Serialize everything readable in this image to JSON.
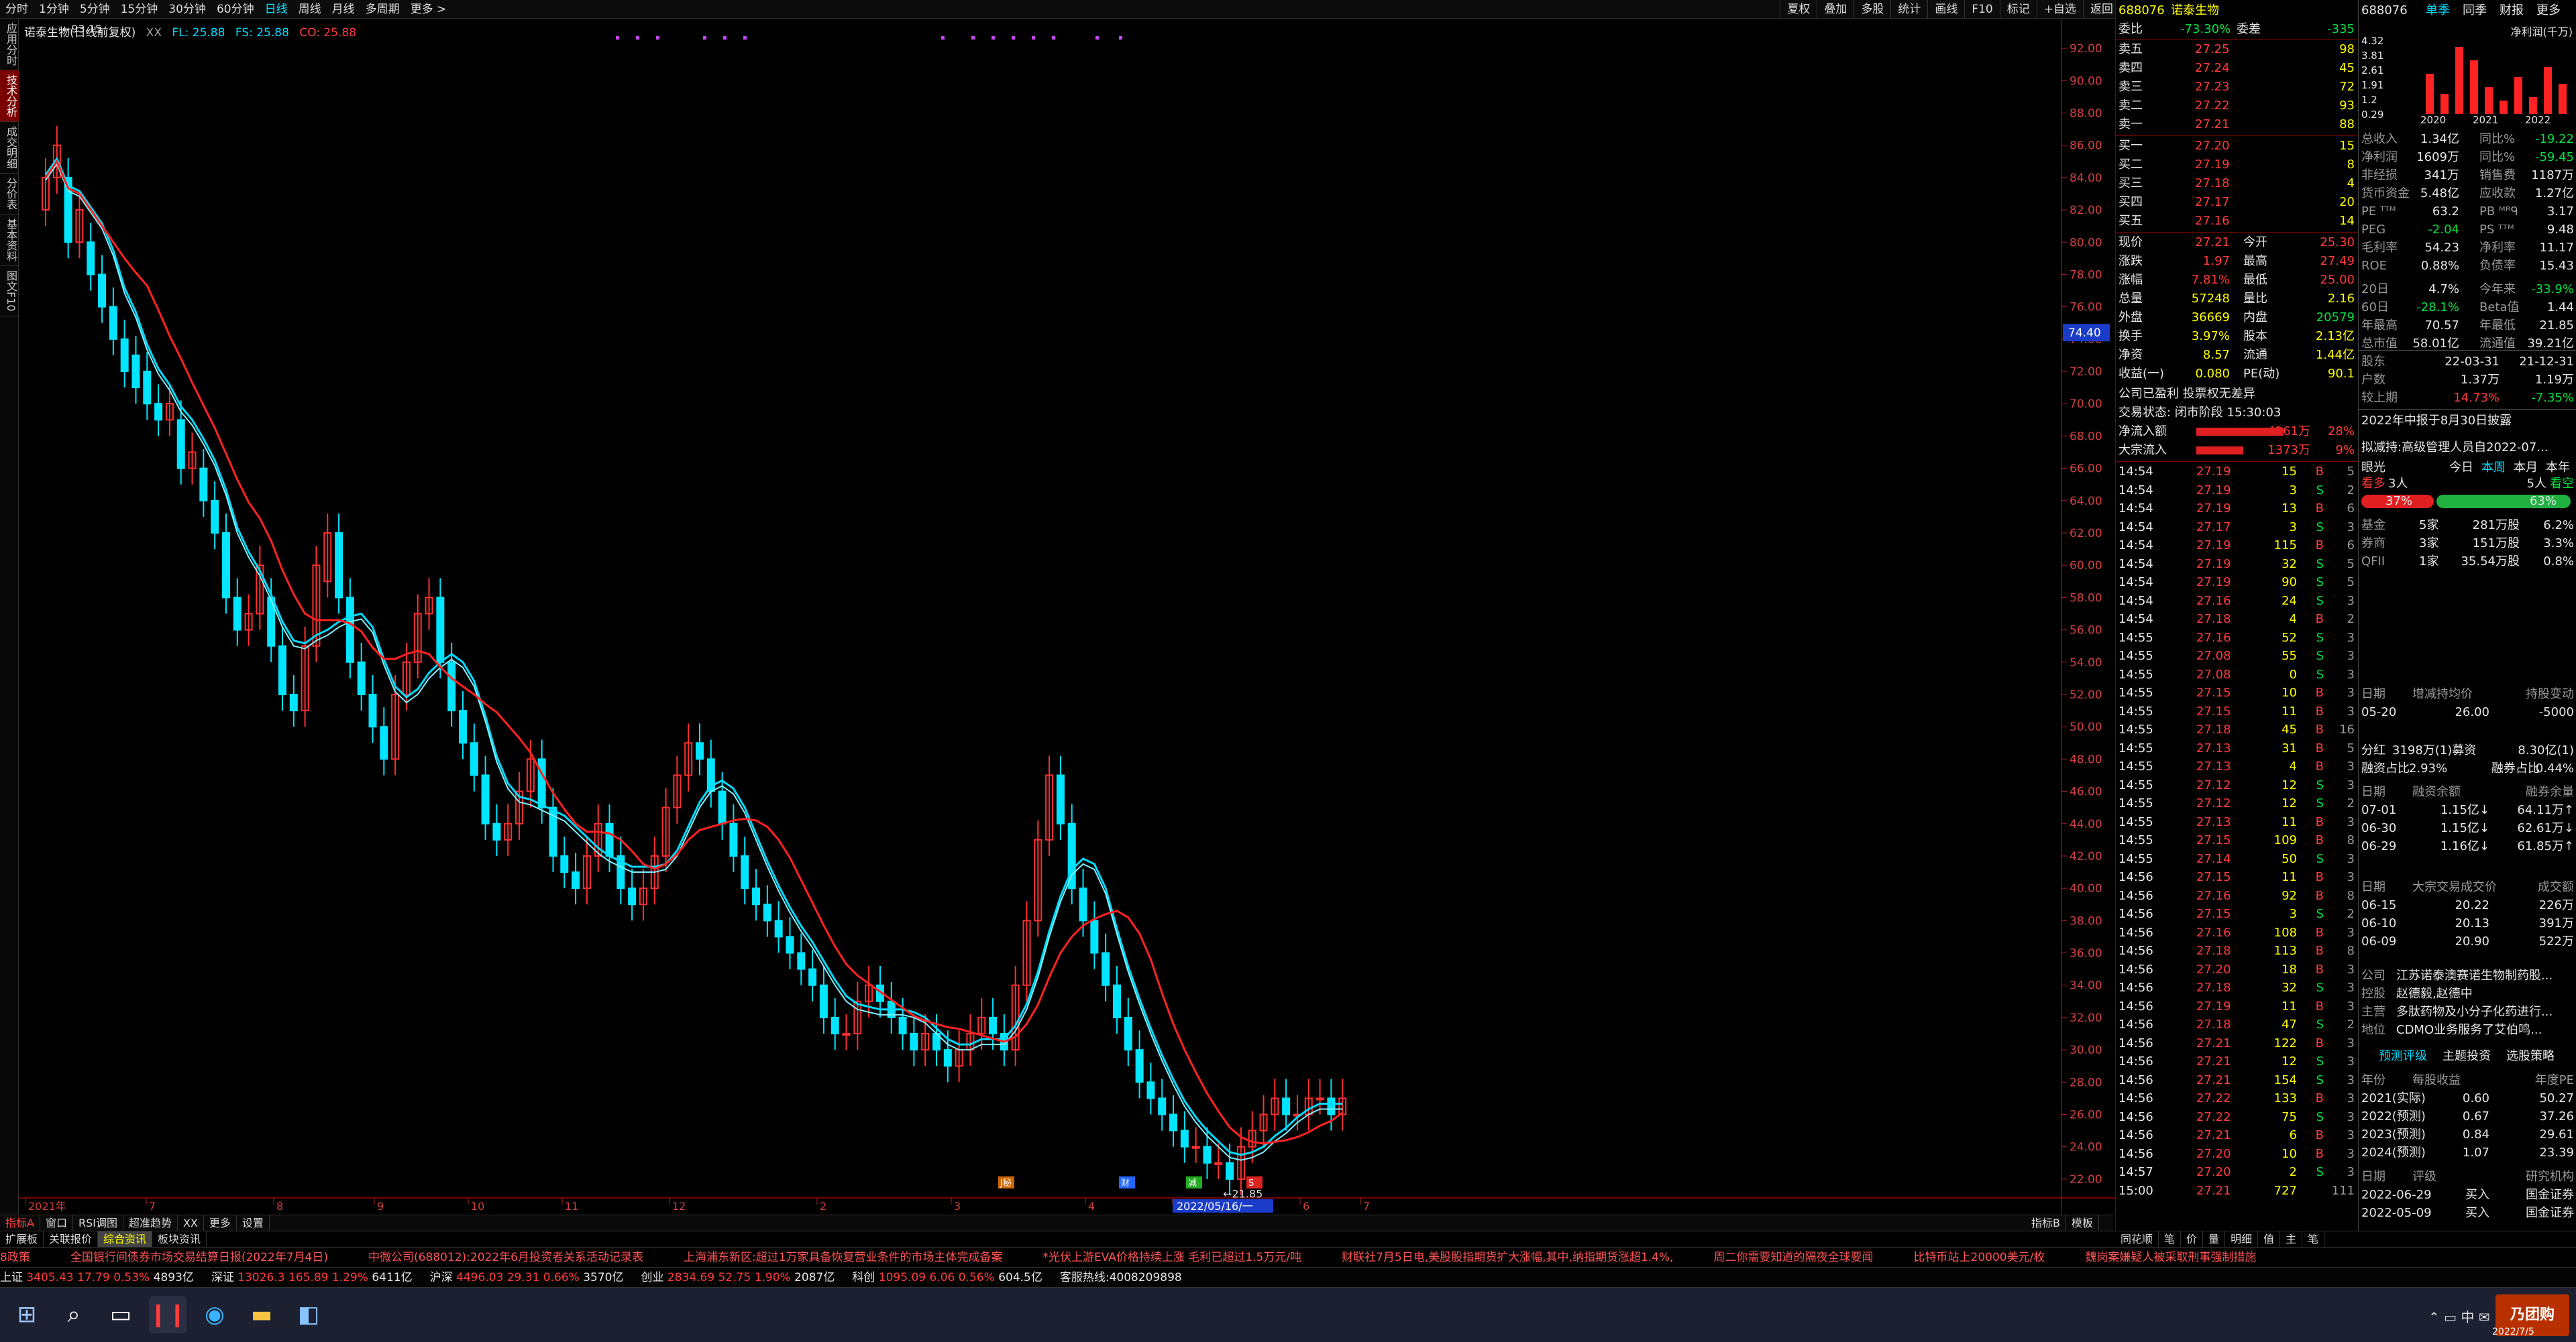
{
  "periods": [
    "分时",
    "1分钟",
    "5分钟",
    "15分钟",
    "30分钟",
    "60分钟",
    "日线",
    "周线",
    "月线",
    "多周期",
    "更多 >"
  ],
  "active_period": "日线",
  "top_buttons": [
    "夏权",
    "叠加",
    "多股",
    "统计",
    "画线",
    "F10",
    "标记",
    "+自选",
    "返回"
  ],
  "left_tabs": [
    "应用分时",
    "技术分析",
    "成交明细",
    "分价表",
    "基本资料",
    "图文F10"
  ],
  "legend": {
    "name": "诺泰生物(日线前复权)",
    "xx": "XX",
    "fl": "FL: 25.88",
    "fs": "FS: 25.88",
    "co": "CO: 25.88"
  },
  "price_axis": [
    "92.00",
    "90.00",
    "88.00",
    "86.00",
    "84.00",
    "82.00",
    "80.00",
    "78.00",
    "76.00",
    "74.00",
    "72.00",
    "70.00",
    "68.00",
    "66.00",
    "64.00",
    "62.00",
    "60.00",
    "58.00",
    "56.00",
    "54.00",
    "52.00",
    "50.00",
    "48.00",
    "46.00",
    "44.00",
    "42.00",
    "40.00",
    "38.00",
    "36.00",
    "34.00",
    "32.00",
    "30.00",
    "28.00",
    "26.00",
    "24.00",
    "22.00"
  ],
  "crosshair_price": "74.40",
  "high_label": "93.15",
  "low_label": "21.85",
  "date_axis": [
    "2021年",
    "7",
    "8",
    "9",
    "10",
    "11",
    "12",
    "2",
    "3",
    "4",
    "5",
    "6",
    "7"
  ],
  "date_highlight": "2022/05/16/一",
  "event_markers": [
    "J秘",
    "财",
    "减",
    "S"
  ],
  "bottom_tabs": [
    "指标A",
    "窗口",
    "RSI调图",
    "超准趋势",
    "XX",
    "更多",
    "设置"
  ],
  "bottom_right": [
    "指标B",
    "模板",
    "板"
  ],
  "bottom_row2": [
    "扩展板",
    "关联报价",
    "综合资讯",
    "板块资讯"
  ],
  "bottom_row2_right": [
    "同花顺",
    "笔",
    "价",
    "量",
    "明细",
    "值",
    "主",
    "笔"
  ],
  "chart_data": {
    "type": "candlestick",
    "title": "诺泰生物(日线前复权)",
    "ylim": [
      21,
      93
    ],
    "indicators": [
      "FL",
      "FS",
      "CO"
    ],
    "highest": 93.15,
    "lowest": 21.85,
    "overlay_lines": [
      {
        "name": "FL",
        "color": "#00dcff"
      },
      {
        "name": "CO",
        "color": "#ff2222"
      }
    ],
    "closes": [
      84,
      86,
      80,
      82,
      78,
      76,
      74,
      72,
      71,
      70,
      69,
      70,
      66,
      67,
      64,
      62,
      58,
      56,
      57,
      60,
      55,
      52,
      51,
      55,
      60,
      62,
      58,
      54,
      52,
      50,
      48,
      52,
      54,
      57,
      58,
      54,
      51,
      49,
      47,
      44,
      43,
      44,
      46,
      48,
      45,
      42,
      41,
      40,
      42,
      44,
      42,
      40,
      39,
      40,
      42,
      45,
      47,
      49,
      48,
      46,
      44,
      42,
      40,
      39,
      38,
      37,
      36,
      35,
      34,
      32,
      31,
      31,
      33,
      34,
      33,
      32,
      31,
      30,
      31,
      30,
      29,
      30,
      31,
      32,
      31,
      30,
      34,
      38,
      43,
      47,
      44,
      40,
      38,
      36,
      34,
      32,
      30,
      28,
      27,
      26,
      25,
      24,
      24,
      23,
      23,
      22,
      24,
      25,
      26,
      27,
      26,
      26,
      27,
      27,
      26,
      27
    ],
    "opens": [
      82,
      84,
      84,
      80,
      80,
      78,
      76,
      74,
      73,
      72,
      70,
      69,
      69,
      66,
      66,
      64,
      62,
      58,
      56,
      57,
      58,
      55,
      52,
      51,
      55,
      59,
      62,
      58,
      54,
      52,
      50,
      48,
      52,
      54,
      57,
      58,
      54,
      51,
      49,
      47,
      44,
      43,
      44,
      46,
      48,
      45,
      42,
      41,
      40,
      42,
      44,
      42,
      40,
      39,
      40,
      42,
      45,
      47,
      49,
      48,
      46,
      44,
      42,
      40,
      39,
      38,
      37,
      36,
      35,
      34,
      32,
      31,
      31,
      33,
      34,
      33,
      32,
      31,
      30,
      31,
      30,
      29,
      30,
      31,
      32,
      31,
      30,
      34,
      38,
      43,
      47,
      44,
      40,
      38,
      36,
      34,
      32,
      30,
      28,
      27,
      26,
      25,
      24,
      24,
      23,
      23,
      22,
      24,
      25,
      26,
      27,
      26,
      26,
      27,
      27,
      26
    ]
  },
  "quote": {
    "code": "688076",
    "name": "诺泰生物",
    "weibi_label": "委比",
    "weibi": "-73.30%",
    "weicha_label": "委差",
    "weicha": "-335",
    "sells": [
      [
        "卖五",
        "27.25",
        "98"
      ],
      [
        "卖四",
        "27.24",
        "45"
      ],
      [
        "卖三",
        "27.23",
        "72"
      ],
      [
        "卖二",
        "27.22",
        "93"
      ],
      [
        "卖一",
        "27.21",
        "88"
      ]
    ],
    "buys": [
      [
        "买一",
        "27.20",
        "15"
      ],
      [
        "买二",
        "27.19",
        "8"
      ],
      [
        "买三",
        "27.18",
        "4"
      ],
      [
        "买四",
        "27.17",
        "20"
      ],
      [
        "买五",
        "27.16",
        "14"
      ]
    ],
    "stats": [
      [
        "现价",
        "27.21",
        "今开",
        "25.30"
      ],
      [
        "涨跌",
        "1.97",
        "最高",
        "27.49"
      ],
      [
        "涨幅",
        "7.81%",
        "最低",
        "25.00"
      ],
      [
        "总量",
        "57248",
        "量比",
        "2.16"
      ],
      [
        "外盘",
        "36669",
        "内盘",
        "20579"
      ],
      [
        "换手",
        "3.97%",
        "股本",
        "2.13亿"
      ],
      [
        "净资",
        "8.57",
        "流通",
        "1.44亿"
      ],
      [
        "收益(一)",
        "0.080",
        "PE(动)",
        "90.1"
      ]
    ],
    "notice": "公司已盈利 投票权无差异",
    "status": "交易状态: 闭市阶段 15:30:03",
    "flow": [
      [
        "净流入额",
        "4261万",
        "28%"
      ],
      [
        "大宗流入",
        "1373万",
        "9%"
      ]
    ],
    "ticks": [
      [
        "14:54",
        "27.19",
        "15",
        "B",
        "5"
      ],
      [
        "14:54",
        "27.19",
        "3",
        "S",
        "2"
      ],
      [
        "14:54",
        "27.19",
        "13",
        "B",
        "6"
      ],
      [
        "14:54",
        "27.17",
        "3",
        "S",
        "3"
      ],
      [
        "14:54",
        "27.19",
        "115",
        "B",
        "6"
      ],
      [
        "14:54",
        "27.19",
        "32",
        "S",
        "5"
      ],
      [
        "14:54",
        "27.19",
        "90",
        "S",
        "5"
      ],
      [
        "14:54",
        "27.16",
        "24",
        "S",
        "3"
      ],
      [
        "14:54",
        "27.18",
        "4",
        "B",
        "2"
      ],
      [
        "14:55",
        "27.16",
        "52",
        "S",
        "3"
      ],
      [
        "14:55",
        "27.08",
        "55",
        "S",
        "3"
      ],
      [
        "14:55",
        "27.08",
        "0",
        "S",
        "3"
      ],
      [
        "14:55",
        "27.15",
        "10",
        "B",
        "3"
      ],
      [
        "14:55",
        "27.15",
        "11",
        "B",
        "3"
      ],
      [
        "14:55",
        "27.18",
        "45",
        "B",
        "16"
      ],
      [
        "14:55",
        "27.13",
        "31",
        "B",
        "5"
      ],
      [
        "14:55",
        "27.13",
        "4",
        "B",
        "3"
      ],
      [
        "14:55",
        "27.12",
        "12",
        "S",
        "3"
      ],
      [
        "14:55",
        "27.12",
        "12",
        "S",
        "2"
      ],
      [
        "14:55",
        "27.13",
        "11",
        "B",
        "3"
      ],
      [
        "14:55",
        "27.15",
        "109",
        "B",
        "8"
      ],
      [
        "14:55",
        "27.14",
        "50",
        "S",
        "3"
      ],
      [
        "14:56",
        "27.15",
        "11",
        "B",
        "3"
      ],
      [
        "14:56",
        "27.16",
        "92",
        "B",
        "8"
      ],
      [
        "14:56",
        "27.15",
        "3",
        "S",
        "2"
      ],
      [
        "14:56",
        "27.16",
        "108",
        "B",
        "3"
      ],
      [
        "14:56",
        "27.18",
        "113",
        "B",
        "8"
      ],
      [
        "14:56",
        "27.20",
        "18",
        "B",
        "3"
      ],
      [
        "14:56",
        "27.18",
        "32",
        "S",
        "3"
      ],
      [
        "14:56",
        "27.19",
        "11",
        "B",
        "3"
      ],
      [
        "14:56",
        "27.18",
        "47",
        "S",
        "2"
      ],
      [
        "14:56",
        "27.21",
        "122",
        "B",
        "3"
      ],
      [
        "14:56",
        "27.21",
        "12",
        "S",
        "3"
      ],
      [
        "14:56",
        "27.21",
        "154",
        "S",
        "3"
      ],
      [
        "14:56",
        "27.22",
        "133",
        "B",
        "3"
      ],
      [
        "14:56",
        "27.22",
        "75",
        "S",
        "3"
      ],
      [
        "14:56",
        "27.21",
        "6",
        "B",
        "3"
      ],
      [
        "14:56",
        "27.20",
        "10",
        "B",
        "3"
      ],
      [
        "14:57",
        "27.20",
        "2",
        "S",
        "3"
      ],
      [
        "15:00",
        "27.21",
        "727",
        "",
        "111"
      ]
    ]
  },
  "side": {
    "code": "688076",
    "tabs": [
      "单季",
      "同季",
      "财报",
      "更多"
    ],
    "profit_title": "净利润(千万)",
    "profit_axis": [
      "4.32",
      "3.81",
      "2.61",
      "1.91",
      "1.2",
      "0.29"
    ],
    "years": [
      "2020",
      "2021",
      "2022"
    ],
    "fin": [
      [
        "总收入",
        "1.34亿",
        "同比%",
        "-19.22"
      ],
      [
        "净利润",
        "1609万",
        "同比%",
        "-59.45"
      ],
      [
        "非经损",
        "341万",
        "销售费",
        "1187万"
      ],
      [
        "货币资金",
        "5.48亿",
        "应收款",
        "1.27亿"
      ],
      [
        "PE ᵀᵀᴹ",
        "63.2",
        "PB ᴹᴿᑫ",
        "3.17"
      ],
      [
        "PEG",
        "-2.04",
        "PS ᵀᵀᴹ",
        "9.48"
      ],
      [
        "毛利率",
        "54.23",
        "净利率",
        "11.17"
      ],
      [
        "ROE",
        "0.88%",
        "负债率",
        "15.43"
      ],
      [
        "20日",
        "4.7%",
        "今年来",
        "-33.9%"
      ],
      [
        "60日",
        "-28.1%",
        "Beta值",
        "1.44"
      ],
      [
        "年最高",
        "70.57",
        "年最低",
        "21.85"
      ],
      [
        "总市值",
        "58.01亿",
        "流通值",
        "39.21亿"
      ]
    ],
    "holders": [
      [
        "股东",
        "22-03-31",
        "21-12-31"
      ],
      [
        "户数",
        "1.37万",
        "1.19万"
      ],
      [
        "较上期",
        "14.73%",
        "-7.35%"
      ]
    ],
    "disclose": "2022年中报于8月30日披露",
    "reduce": "拟减持:高级管理人员自2022-07...",
    "view": {
      "label": "眼光",
      "tabs": [
        "今日",
        "本周",
        "本月",
        "本年"
      ],
      "bull": "看多",
      "bull_n": "3人",
      "bear_n": "5人",
      "bear": "看空",
      "bull_pct": "37%",
      "bear_pct": "63%"
    },
    "inst": [
      [
        "基金",
        "5家",
        "281万股",
        "6.2%"
      ],
      [
        "券商",
        "3家",
        "151万股",
        "3.3%"
      ],
      [
        "QFII",
        "1家",
        "35.54万股",
        "0.8%"
      ]
    ],
    "reduce_table": {
      "head": [
        "日期",
        "增减持均价",
        "持股变动"
      ],
      "rows": [
        [
          "05-20",
          "26.00",
          "-5000"
        ]
      ]
    },
    "margin": [
      [
        "分红",
        "3198万(1)募资",
        "8.30亿(1)"
      ],
      [
        "融资占比",
        "2.93%",
        "融券占比",
        "0.44%"
      ]
    ],
    "margin_table": {
      "head": [
        "日期",
        "融资余额",
        "融券余量"
      ],
      "rows": [
        [
          "07-01",
          "1.15亿↓",
          "64.11万↑"
        ],
        [
          "06-30",
          "1.15亿↓",
          "62.61万↓"
        ],
        [
          "06-29",
          "1.16亿↓",
          "61.85万↑"
        ]
      ]
    },
    "block_table": {
      "head": [
        "日期",
        "大宗交易成交价",
        "成交额"
      ],
      "rows": [
        [
          "06-15",
          "20.22",
          "226万"
        ],
        [
          "06-10",
          "20.13",
          "391万"
        ],
        [
          "06-09",
          "20.90",
          "522万"
        ]
      ]
    },
    "company": [
      [
        "公司",
        "江苏诺泰澳赛诺生物制药股..."
      ],
      [
        "控股",
        "赵德毅,赵德中"
      ],
      [
        "主营",
        "多肽药物及小分子化药进行..."
      ],
      [
        "地位",
        "CDMO业务服务了艾伯鸣..."
      ]
    ],
    "forecast_tabs": [
      "预测评级",
      "主题投资",
      "选股策略"
    ],
    "forecast": {
      "head": [
        "年份",
        "每股收益",
        "年度PE"
      ],
      "rows": [
        [
          "2021(实际)",
          "0.60",
          "50.27"
        ],
        [
          "2022(预测)",
          "0.67",
          "37.26"
        ],
        [
          "2023(预测)",
          "0.84",
          "29.61"
        ],
        [
          "2024(预测)",
          "1.07",
          "23.39"
        ]
      ]
    },
    "rating": {
      "head": [
        "日期",
        "评级",
        "研究机构"
      ],
      "rows": [
        [
          "2022-06-29",
          "买入",
          "国金证券"
        ],
        [
          "2022-05-09",
          "买入",
          "国金证券"
        ]
      ]
    }
  },
  "ticker": [
    "8政策",
    "全国银行间债券市场交易结算日报(2022年7月4日)",
    "中微公司(688012):2022年6月投资者关系活动记录表",
    "上海浦东新区:超过1万家具备恢复营业条件的市场主体完成备案",
    "*光伏上游EVA价格持续上涨 毛利已超过1.5万元/吨",
    "财联社7月5日电,美股股指期货扩大涨幅,其中,纳指期货涨超1.4%,",
    "周二你需要知道的隔夜全球要闻",
    "比特币站上20000美元/枚",
    "魏岗案嫌疑人被采取刑事强制措施"
  ],
  "indexbar": [
    {
      "name": "上证",
      "v": "3405.43",
      "c": "17.79",
      "p": "0.53%",
      "a": "4893亿"
    },
    {
      "name": "深证",
      "v": "13026.3",
      "c": "165.89",
      "p": "1.29%",
      "a": "6411亿"
    },
    {
      "name": "沪深",
      "v": "4496.03",
      "c": "29.31",
      "p": "0.66%",
      "a": "3570亿"
    },
    {
      "name": "创业",
      "v": "2834.69",
      "c": "52.75",
      "p": "1.90%",
      "a": "2087亿"
    },
    {
      "name": "科创",
      "v": "1095.09",
      "c": "6.06",
      "p": "0.56%",
      "a": "604.5亿"
    }
  ],
  "hotline": "客服热线:4008209898",
  "taskbar": {
    "time": "2022/7/5",
    "brand": "乃团购"
  }
}
